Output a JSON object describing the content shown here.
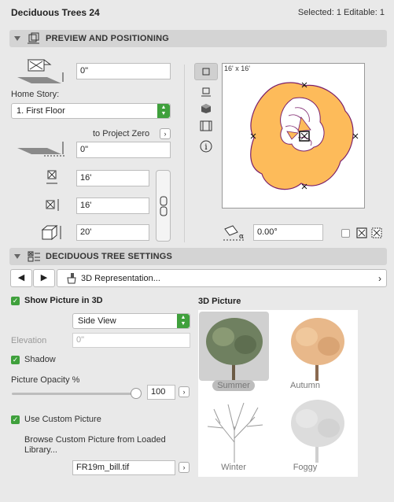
{
  "window": {
    "title": "Deciduous Trees 24",
    "selection_info": "Selected: 1 Editable: 1"
  },
  "sections": {
    "preview": {
      "title": "PREVIEW AND POSITIONING"
    },
    "settings": {
      "title": "DECIDUOUS TREE SETTINGS"
    }
  },
  "positioning": {
    "elevation_value": "0\"",
    "home_story_label": "Home Story:",
    "home_story_value": "1. First Floor",
    "to_project_zero_label": "to Project Zero",
    "project_zero_value": "0\"",
    "width_x": "16'",
    "width_y": "16'",
    "height": "20'"
  },
  "preview_panel": {
    "dimension_label": "16' x 16'",
    "angle_value": "0.00°"
  },
  "settings": {
    "nav_label": "3D Representation...",
    "show_picture_label": "Show Picture in 3D",
    "view_value": "Side View",
    "elevation_label": "Elevation",
    "elevation_placeholder": "0\"",
    "shadow_label": "Shadow",
    "opacity_label": "Picture Opacity %",
    "opacity_value": "100",
    "opacity_level": 1.0,
    "custom_picture_label": "Use Custom Picture",
    "browse_label_1": "Browse Custom Picture from Loaded",
    "browse_label_2": "Library...",
    "file_value": "FR19m_bill.tif"
  },
  "picture_3d": {
    "title": "3D Picture",
    "options": [
      {
        "label": "Summer",
        "selected": true
      },
      {
        "label": "Autumn",
        "selected": false
      },
      {
        "label": "Winter",
        "selected": false
      },
      {
        "label": "Foggy",
        "selected": false
      }
    ]
  },
  "colors": {
    "accent_green": "#3fa03c",
    "tree_fill": "#fdbb5a",
    "tree_outline": "#7a1f6a"
  }
}
